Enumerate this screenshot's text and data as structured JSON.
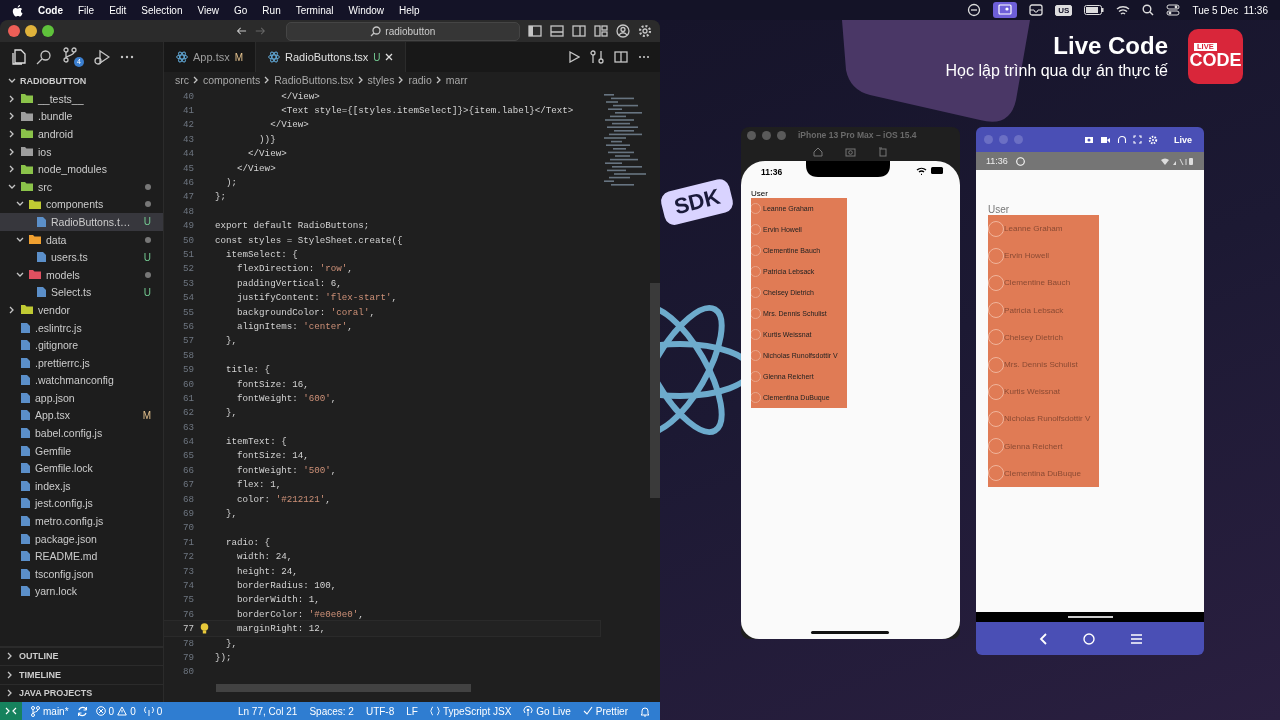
{
  "menu_bar": {
    "app": "Code",
    "menus": [
      "File",
      "Edit",
      "Selection",
      "View",
      "Go",
      "Run",
      "Terminal",
      "Window",
      "Help"
    ],
    "input_source": "US",
    "clock": "Tue 5 Dec  11:36"
  },
  "editor_window": {
    "search": "radiobutton",
    "source_control_badge": "4",
    "tabs": [
      {
        "label": "App.tsx",
        "status": "M",
        "selected": false
      },
      {
        "label": "RadioButtons.tsx",
        "status": "U",
        "selected": true
      }
    ],
    "breadcrumb": [
      "src",
      "components",
      "RadioButtons.tsx",
      "styles",
      "radio",
      "marr"
    ],
    "explorer": {
      "title": "RADIOBUTTON",
      "items": [
        {
          "name": "__tests__",
          "kind": "folder",
          "expanded": false,
          "modified": false,
          "selected": false
        },
        {
          "name": ".bundle",
          "kind": "folder",
          "expanded": false,
          "modified": false,
          "selected": false
        },
        {
          "name": "android",
          "kind": "folder",
          "expanded": false,
          "modified": false,
          "selected": false
        },
        {
          "name": "ios",
          "kind": "folder",
          "expanded": false,
          "modified": false,
          "selected": false
        },
        {
          "name": "node_modules",
          "kind": "folder",
          "expanded": false,
          "modified": false,
          "selected": false
        },
        {
          "name": "src",
          "kind": "folder",
          "expanded": true,
          "modified": true,
          "selected": false,
          "children": [
            {
              "name": "components",
              "kind": "folder",
              "expanded": true,
              "modified": true,
              "selected": false,
              "children": [
                {
                  "name": "RadioButtons.t…",
                  "kind": "file",
                  "badge": "U",
                  "selected": true
                }
              ]
            },
            {
              "name": "data",
              "kind": "folder",
              "expanded": true,
              "modified": true,
              "selected": false,
              "children": [
                {
                  "name": "users.ts",
                  "kind": "file",
                  "badge": "U",
                  "selected": false
                }
              ]
            },
            {
              "name": "models",
              "kind": "folder",
              "expanded": true,
              "modified": true,
              "selected": false,
              "children": [
                {
                  "name": "Select.ts",
                  "kind": "file",
                  "badge": "U",
                  "selected": false
                }
              ]
            }
          ]
        },
        {
          "name": "vendor",
          "kind": "folder",
          "expanded": false,
          "modified": false,
          "selected": false
        },
        {
          "name": ".eslintrc.js",
          "kind": "file",
          "selected": false
        },
        {
          "name": ".gitignore",
          "kind": "file",
          "selected": false
        },
        {
          "name": ".prettierrc.js",
          "kind": "file",
          "selected": false
        },
        {
          "name": ".watchmanconfig",
          "kind": "file",
          "selected": false
        },
        {
          "name": "app.json",
          "kind": "file",
          "selected": false
        },
        {
          "name": "App.tsx",
          "kind": "file",
          "badge": "M",
          "selected": false
        },
        {
          "name": "babel.config.js",
          "kind": "file",
          "selected": false
        },
        {
          "name": "Gemfile",
          "kind": "file",
          "selected": false
        },
        {
          "name": "Gemfile.lock",
          "kind": "file",
          "selected": false
        },
        {
          "name": "index.js",
          "kind": "file",
          "selected": false
        },
        {
          "name": "jest.config.js",
          "kind": "file",
          "selected": false
        },
        {
          "name": "metro.config.js",
          "kind": "file",
          "selected": false
        },
        {
          "name": "package.json",
          "kind": "file",
          "selected": false
        },
        {
          "name": "README.md",
          "kind": "file",
          "selected": false
        },
        {
          "name": "tsconfig.json",
          "kind": "file",
          "selected": false
        },
        {
          "name": "yarn.lock",
          "kind": "file",
          "selected": false
        }
      ]
    },
    "panels": [
      "OUTLINE",
      "TIMELINE",
      "JAVA PROJECTS"
    ],
    "code_lines": [
      {
        "number": "40",
        "text": "            </View>",
        "current": false
      },
      {
        "number": "41",
        "text": "            <Text style={[styles.itemSelect]}>{item.label}</Text>",
        "current": false
      },
      {
        "number": "42",
        "text": "          </View>",
        "current": false
      },
      {
        "number": "43",
        "text": "        ))}",
        "current": false
      },
      {
        "number": "44",
        "text": "      </View>",
        "current": false
      },
      {
        "number": "45",
        "text": "    </View>",
        "current": false
      },
      {
        "number": "46",
        "text": "  );",
        "current": false
      },
      {
        "number": "47",
        "text": "};",
        "current": false
      },
      {
        "number": "48",
        "current": false
      },
      {
        "number": "49",
        "text": "export default RadioButtons;",
        "current": false
      },
      {
        "number": "50",
        "text": "const styles = StyleSheet.create({",
        "current": false
      },
      {
        "number": "51",
        "text": "  itemSelect: {",
        "current": false
      },
      {
        "number": "52",
        "text": "    flexDirection: 'row',",
        "current": false
      },
      {
        "number": "53",
        "text": "    paddingVertical: 6,",
        "current": false
      },
      {
        "number": "54",
        "text": "    justifyContent: 'flex-start',",
        "current": false
      },
      {
        "number": "55",
        "text": "    backgroundColor: 'coral',",
        "current": false
      },
      {
        "number": "56",
        "text": "    alignItems: 'center',",
        "current": false
      },
      {
        "number": "57",
        "text": "  },",
        "current": false
      },
      {
        "number": "58",
        "current": false
      },
      {
        "number": "59",
        "text": "  title: {",
        "current": false
      },
      {
        "number": "60",
        "text": "    fontSize: 16,",
        "current": false
      },
      {
        "number": "61",
        "text": "    fontWeight: '600',",
        "current": false
      },
      {
        "number": "62",
        "text": "  },",
        "current": false
      },
      {
        "number": "63",
        "current": false
      },
      {
        "number": "64",
        "text": "  itemText: {",
        "current": false
      },
      {
        "number": "65",
        "text": "    fontSize: 14,",
        "current": false
      },
      {
        "number": "66",
        "text": "    fontWeight: '500',",
        "current": false
      },
      {
        "number": "67",
        "text": "    flex: 1,",
        "current": false
      },
      {
        "number": "68",
        "text": "    color: '#212121',",
        "current": false
      },
      {
        "number": "69",
        "text": "  },",
        "current": false
      },
      {
        "number": "70",
        "current": false
      },
      {
        "number": "71",
        "text": "  radio: {",
        "current": false
      },
      {
        "number": "72",
        "text": "    width: 24,",
        "current": false
      },
      {
        "number": "73",
        "text": "    height: 24,",
        "current": false
      },
      {
        "number": "74",
        "text": "    borderRadius: 100,",
        "current": false
      },
      {
        "number": "75",
        "text": "    borderWidth: 1,",
        "current": false
      },
      {
        "number": "76",
        "text": "    borderColor: '#e0e0e0',",
        "current": false
      },
      {
        "number": "77",
        "text": "    marginRight: 12,",
        "current": true
      },
      {
        "number": "78",
        "text": "  },",
        "current": false
      },
      {
        "number": "79",
        "text": "});",
        "current": false
      },
      {
        "number": "80",
        "current": false
      }
    ],
    "status_bar": {
      "branch": "main*",
      "errors": "0",
      "warnings": "0",
      "ports": "0",
      "position": "Ln 77, Col 21",
      "indent": "Spaces: 2",
      "encoding": "UTF-8",
      "eol": "LF",
      "language": "TypeScript JSX",
      "live": "Go Live",
      "formatter": "Prettier"
    }
  },
  "banner": {
    "title": "Live Code",
    "subtitle": "Học lập trình qua dự án thực tế",
    "logo_badge": "LIVE",
    "logo_text": "CODE"
  },
  "decoration": {
    "tag": "SDK"
  },
  "ios_simulator": {
    "title": "iPhone 13 Pro Max – iOS 15.4",
    "time": "11:36",
    "heading": "User",
    "options": [
      {
        "label": "Leanne Graham",
        "selected": false
      },
      {
        "label": "Ervin Howell",
        "selected": false
      },
      {
        "label": "Clementine Bauch",
        "selected": false
      },
      {
        "label": "Patricia Lebsack",
        "selected": false
      },
      {
        "label": "Chelsey Dietrich",
        "selected": false
      },
      {
        "label": "Mrs. Dennis Schulist",
        "selected": false
      },
      {
        "label": "Kurtis Weissnat",
        "selected": false
      },
      {
        "label": "Nicholas Runolfsdottir V",
        "selected": false
      },
      {
        "label": "Glenna Reichert",
        "selected": false
      },
      {
        "label": "Clementina DuBuque",
        "selected": false
      }
    ]
  },
  "android_emulator": {
    "label": "Live",
    "time": "11:36",
    "heading": "User",
    "options": [
      {
        "label": "Leanne Graham",
        "selected": false
      },
      {
        "label": "Ervin Howell",
        "selected": false
      },
      {
        "label": "Clementine Bauch",
        "selected": false
      },
      {
        "label": "Patricia Lebsack",
        "selected": false
      },
      {
        "label": "Chelsey Dietrich",
        "selected": false
      },
      {
        "label": "Mrs. Dennis Schulist",
        "selected": false
      },
      {
        "label": "Kurtis Weissnat",
        "selected": false
      },
      {
        "label": "Nicholas Runolfsdottir V",
        "selected": false
      },
      {
        "label": "Glenna Reichert",
        "selected": false
      },
      {
        "label": "Clementina DuBuque",
        "selected": false
      }
    ]
  }
}
